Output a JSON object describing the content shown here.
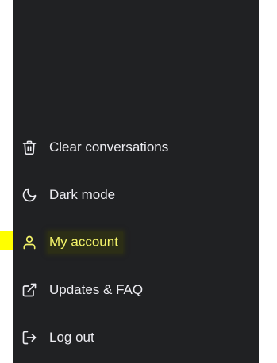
{
  "menu": {
    "items": [
      {
        "label": "Clear conversations",
        "icon": "trash-icon"
      },
      {
        "label": "Dark mode",
        "icon": "moon-icon"
      },
      {
        "label": "My account",
        "icon": "user-icon"
      },
      {
        "label": "Updates & FAQ",
        "icon": "external-link-icon"
      },
      {
        "label": "Log out",
        "icon": "logout-icon"
      }
    ]
  },
  "colors": {
    "sidebar_bg": "#202123",
    "text": "#ececf1",
    "highlight": "#ffff00",
    "highlight_text": "#f4f46a"
  }
}
